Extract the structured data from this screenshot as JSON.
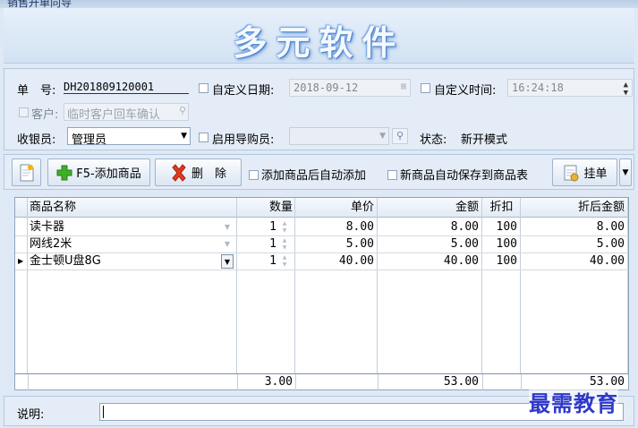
{
  "window": {
    "title": "销售开单向导"
  },
  "banner": {
    "title": "多元软件"
  },
  "form": {
    "order_no_label": "单　号:",
    "order_no_value": "DH201809120001",
    "custom_date_label": "自定义日期:",
    "custom_date_value": "2018-09-12",
    "custom_time_label": "自定义时间:",
    "custom_time_value": "16:24:18",
    "customer_label": "客户:",
    "customer_value": "临时客户回车确认",
    "cashier_label": "收银员:",
    "cashier_value": "管理员",
    "guide_label": "启用导购员:",
    "guide_value": "",
    "status_label": "状态:",
    "status_value": "新开模式"
  },
  "toolbar": {
    "add_product_label": "F5-添加商品",
    "delete_label": "删　除",
    "auto_add_label": "添加商品后自动添加",
    "auto_save_label": "新商品自动保存到商品表",
    "hold_label": "挂单"
  },
  "grid": {
    "columns": {
      "name": "商品名称",
      "qty": "数量",
      "price": "单价",
      "amount": "金额",
      "discount": "折扣",
      "net": "折后金额"
    },
    "rows": [
      {
        "name": "读卡器",
        "qty": "1",
        "price": "8.00",
        "amount": "8.00",
        "discount": "100",
        "net": "8.00"
      },
      {
        "name": "网线2米",
        "qty": "1",
        "price": "5.00",
        "amount": "5.00",
        "discount": "100",
        "net": "5.00"
      },
      {
        "name": "金士顿U盘8G",
        "qty": "1",
        "price": "40.00",
        "amount": "40.00",
        "discount": "100",
        "net": "40.00"
      }
    ],
    "totals": {
      "qty": "3.00",
      "amount": "53.00",
      "net": "53.00"
    }
  },
  "description": {
    "label": "说明:",
    "value": ""
  },
  "watermark": {
    "text": "最需教育"
  },
  "colors": {
    "accent": "#2f39c9",
    "panel": "#e4ecf7",
    "border": "#b3c7df"
  }
}
